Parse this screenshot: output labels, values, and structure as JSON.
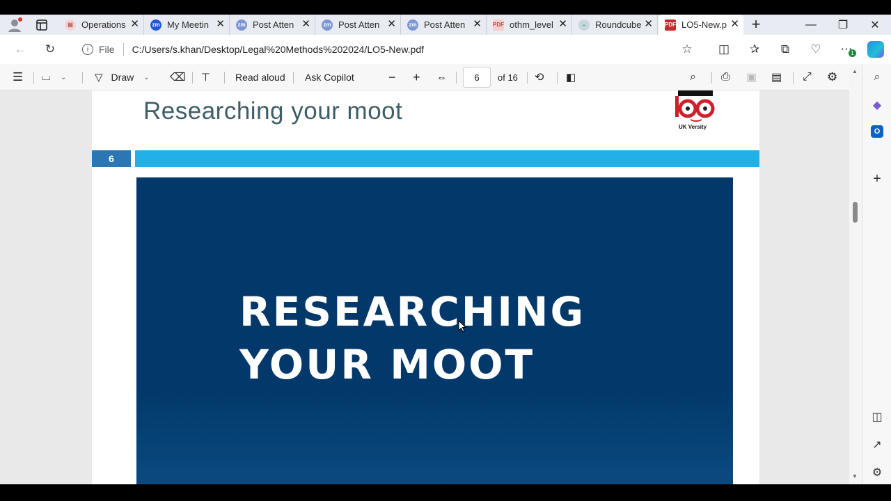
{
  "tabs": [
    {
      "title": "Operations",
      "favicon": "document-icon",
      "color": "#c97a7a"
    },
    {
      "title": "My Meetin",
      "favicon": "zm-icon",
      "color": "#1f57d8"
    },
    {
      "title": "Post Atten",
      "favicon": "zm-icon",
      "color": "#7d96d4"
    },
    {
      "title": "Post Atten",
      "favicon": "zm-icon",
      "color": "#7d96d4"
    },
    {
      "title": "Post Atten",
      "favicon": "zm-icon",
      "color": "#7d96d4"
    },
    {
      "title": "othm_level",
      "favicon": "pdf-icon",
      "color": "#d66"
    },
    {
      "title": "Roundcube",
      "favicon": "roundcube-icon",
      "color": "#9bb"
    },
    {
      "title": "LO5-New.p",
      "favicon": "pdf-icon",
      "color": "#c62b2b",
      "active": true
    }
  ],
  "tab_favicon_text": {
    "zm": "zm",
    "pdf": "PDF"
  },
  "address": {
    "scheme_label": "File",
    "url": "C:/Users/s.khan/Desktop/Legal%20Methods%202024/LO5-New.pdf"
  },
  "pdf_toolbar": {
    "draw_label": "Draw",
    "read_aloud_label": "Read aloud",
    "ask_copilot_label": "Ask Copilot",
    "page_number": "6",
    "page_total": "of 16"
  },
  "document": {
    "heading": "Researching your moot",
    "page_badge": "6",
    "slide_line1": "RESEARCHING",
    "slide_line2": "YOUR MOOT",
    "logo_text": "UK Versity"
  },
  "notification_badge": "1",
  "colors": {
    "accent_blue_band": "#22b0e8",
    "page_badge": "#2b77b5",
    "slide_bg": "#02396a",
    "heading": "#3e5e68"
  }
}
